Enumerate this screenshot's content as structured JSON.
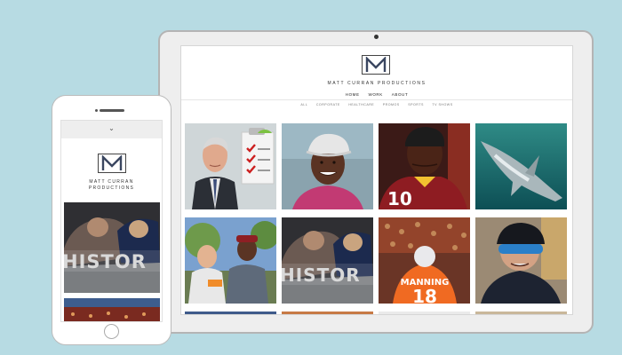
{
  "site": {
    "brand": "MATT CURRAN PRODUCTIONS",
    "brand_line1": "MATT CURRAN",
    "brand_line2": "PRODUCTIONS",
    "logo_letter": "M"
  },
  "nav": {
    "items": [
      "HOME",
      "WORK",
      "ABOUT"
    ]
  },
  "subnav": {
    "items": [
      "ALL",
      "CORPORATE",
      "HEALTHCARE",
      "PROMOS",
      "SPORTS",
      "TV SHOWS"
    ]
  },
  "grid": {
    "tiles": [
      {
        "subject": "older-man-presenter-icon"
      },
      {
        "subject": "smiling-woman-cap-icon"
      },
      {
        "subject": "football-player-10-icon"
      },
      {
        "subject": "shark-underwater-icon"
      },
      {
        "subject": "two-men-outdoors-icon"
      },
      {
        "subject": "football-players-history-icon"
      },
      {
        "subject": "manning-18-jersey-icon"
      },
      {
        "subject": "cyclist-helmet-icon"
      }
    ],
    "overlay_text": {
      "history": "HISTOR",
      "jersey_name": "MANNING",
      "jersey_number": "18",
      "player_number": "10"
    }
  },
  "phone": {
    "menu_icon": "chevron-down-icon"
  },
  "colors": {
    "background": "#b7dbe3",
    "device_frame": "#eeeeee",
    "brand_text": "#333333"
  }
}
